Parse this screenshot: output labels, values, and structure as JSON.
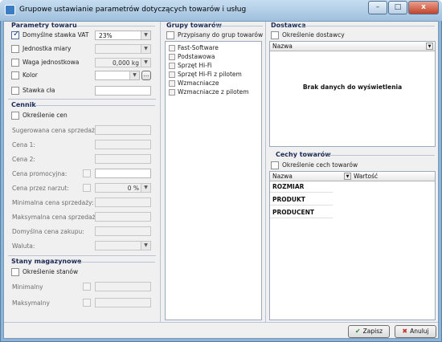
{
  "window": {
    "title": "Grupowe ustawianie parametrów dotyczących towarów i usług",
    "controls": {
      "minimize": "–",
      "maximize": "□",
      "close": "x"
    }
  },
  "parametry": {
    "title": "Parametry towaru",
    "domyslna_vat": {
      "label": "Domyślne stawka VAT",
      "checked": true,
      "value": "23%"
    },
    "jednostka": {
      "label": "Jednostka miary"
    },
    "waga": {
      "label": "Waga jednostkowa",
      "value": "0,000 kg"
    },
    "kolor": {
      "label": "Kolor",
      "button": "..."
    },
    "stawka_cla": {
      "label": "Stawka cła"
    }
  },
  "cennik": {
    "title": "Cennik",
    "okreslenie": "Określenie cen",
    "fields": [
      {
        "label": "Sugerowana cena sprzedaży:"
      },
      {
        "label": "Cena 1:"
      },
      {
        "label": "Cena 2:"
      },
      {
        "label": "Cena promocyjna:"
      },
      {
        "label": "Cena przez narzut:",
        "value": "0 %"
      },
      {
        "label": "Minimalna cena sprzedaży:"
      },
      {
        "label": "Maksymalna cena sprzedaży:"
      },
      {
        "label": "Domyślna cena zakupu:"
      },
      {
        "label": "Waluta:"
      }
    ]
  },
  "stany": {
    "title": "Stany magazynowe",
    "okreslenie": "Określenie stanów",
    "minimalny": "Minimalny",
    "maksymalny": "Maksymalny"
  },
  "grupy": {
    "title": "Grupy towarów",
    "przypisany": "Przypisany do grup towarów",
    "items": [
      "Fast-Software",
      "Podstawowa",
      "Sprzęt Hi-Fi",
      "Sprzęt Hi-Fi z pilotem",
      "Wzmacniacze",
      "Wzmacniacze z pilotem"
    ]
  },
  "dostawca": {
    "title": "Dostawca",
    "okreslenie": "Określenie dostawcy",
    "col_nazwa": "Nazwa",
    "empty": "Brak danych do wyświetlenia"
  },
  "cechy": {
    "title": "Cechy towarów",
    "okreslenie": "Określenie cech towarów",
    "col_nazwa": "Nazwa",
    "col_wartosc": "Wartość",
    "rows": [
      "ROZMIAR",
      "PRODUKT",
      "PRODUCENT"
    ]
  },
  "buttons": {
    "save": "Zapisz",
    "cancel": "Anuluj",
    "save_icon": "✔",
    "cancel_icon": "✖"
  }
}
